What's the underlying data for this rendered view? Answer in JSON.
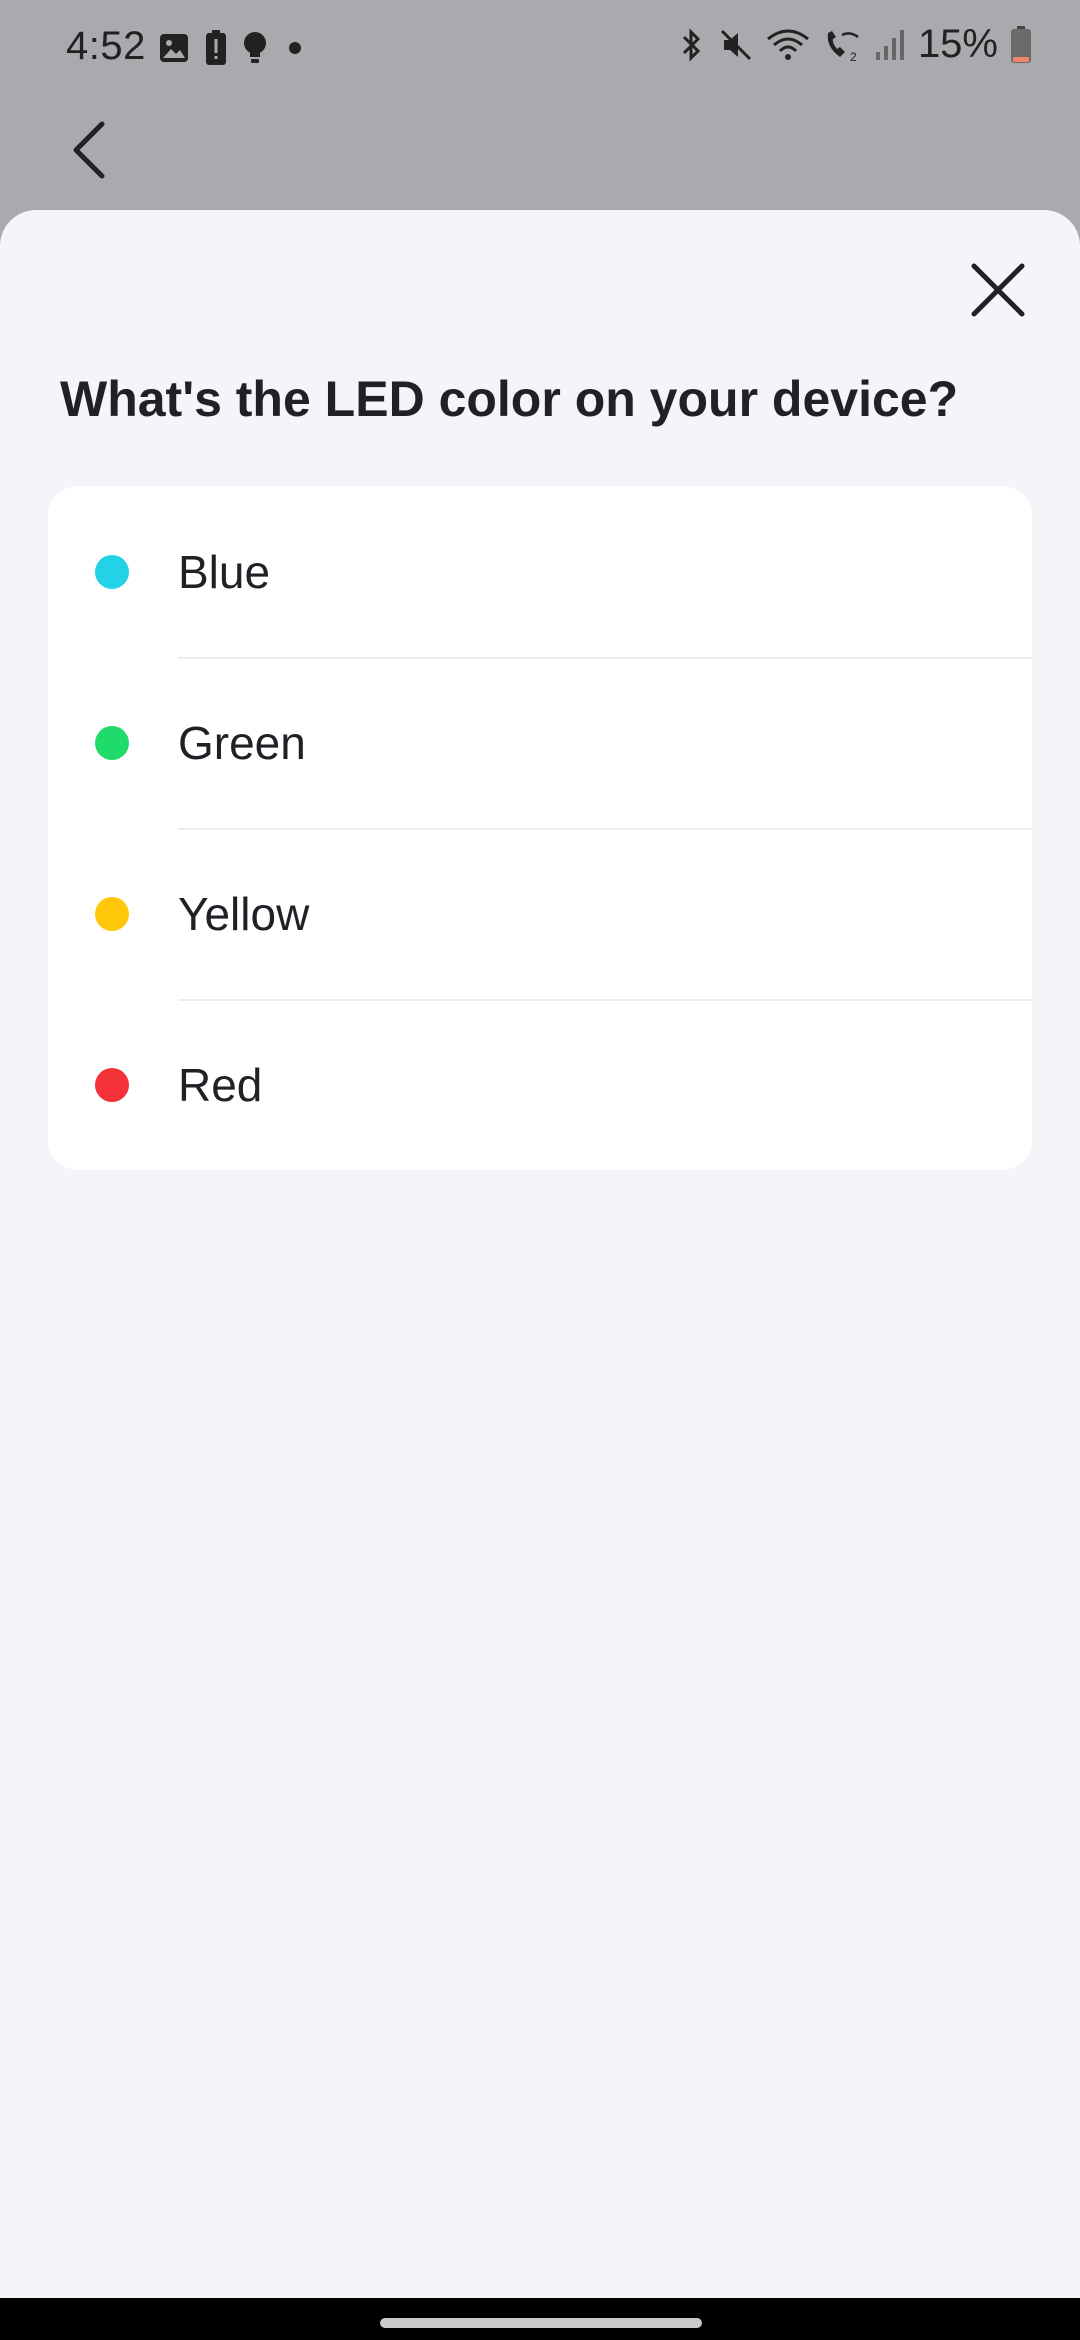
{
  "status_bar": {
    "time": "4:52",
    "battery": "15%",
    "left_icons": [
      "image-icon",
      "battery-alert-icon",
      "bulb-icon",
      "dot-icon"
    ],
    "right_icons": [
      "bluetooth-icon",
      "mute-icon",
      "wifi-icon",
      "wifi-call-icon",
      "signal-icon",
      "battery-icon"
    ]
  },
  "sheet": {
    "title": "What's the LED color on your device?",
    "options": [
      {
        "label": "Blue",
        "color": "#22d3e8"
      },
      {
        "label": "Green",
        "color": "#1fdc6a"
      },
      {
        "label": "Yellow",
        "color": "#ffc70a"
      },
      {
        "label": "Red",
        "color": "#f3323a"
      }
    ]
  },
  "colors": {
    "sheet_background": "#f4f5f9",
    "card_background": "#ffffff",
    "text": "#1f2126",
    "scrim": "#a9aaad"
  }
}
